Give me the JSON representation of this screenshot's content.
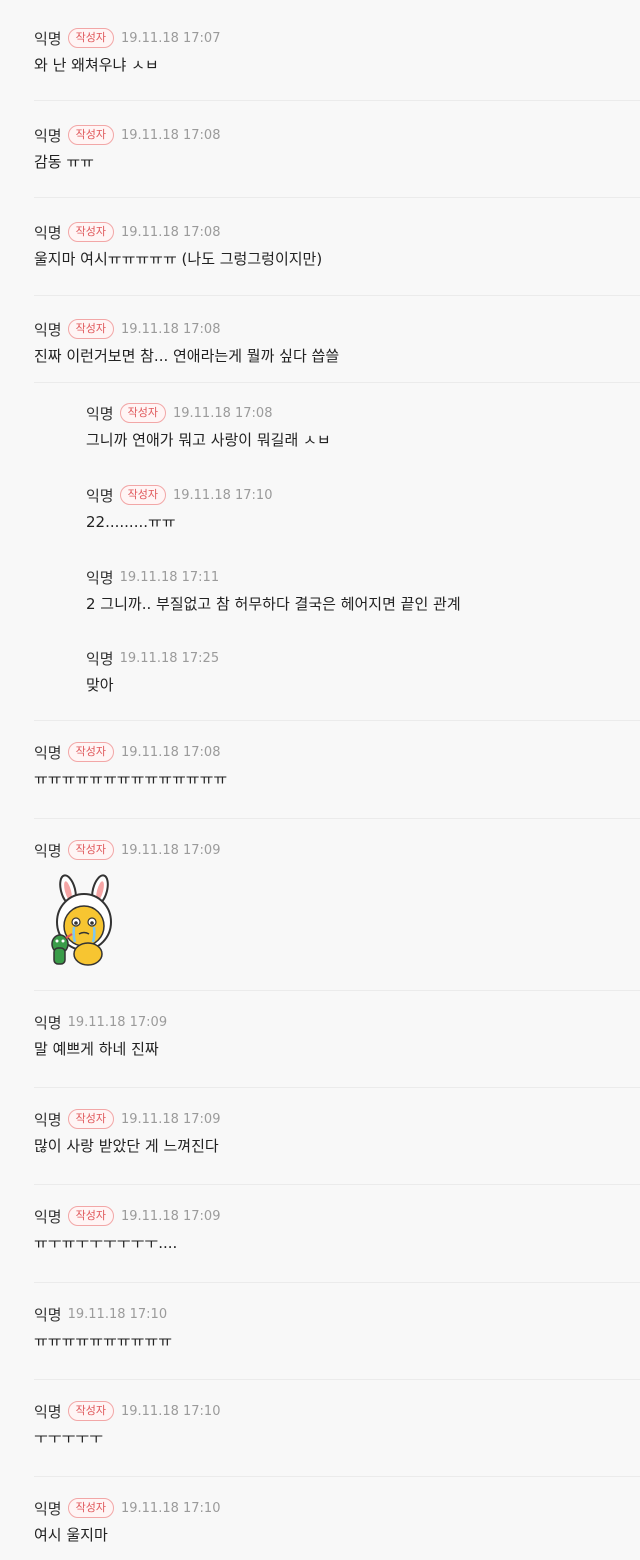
{
  "author_badge": "작성자",
  "comments": [
    {
      "name": "익명",
      "author": true,
      "time": "19.11.18 17:07",
      "text": "와 난 왜쳐우냐 ㅅㅂ",
      "reply": false
    },
    {
      "name": "익명",
      "author": true,
      "time": "19.11.18 17:08",
      "text": "감동 ㅠㅠ",
      "reply": false
    },
    {
      "name": "익명",
      "author": true,
      "time": "19.11.18 17:08",
      "text": "울지마 여시ㅠㅠㅠㅠㅠ (나도 그렁그렁이지만)",
      "reply": false
    },
    {
      "name": "익명",
      "author": true,
      "time": "19.11.18 17:08",
      "text": "진짜 이런거보면 참... 연애라는게 뭘까 싶다 씁쓸",
      "reply": false
    },
    {
      "name": "익명",
      "author": true,
      "time": "19.11.18 17:08",
      "text": "그니까 연애가 뭐고 사랑이 뭐길래 ㅅㅂ",
      "reply": true
    },
    {
      "name": "익명",
      "author": true,
      "time": "19.11.18 17:10",
      "text": "22.........ㅠㅠ",
      "reply": true
    },
    {
      "name": "익명",
      "author": false,
      "time": "19.11.18 17:11",
      "text": "2 그니까.. 부질없고 참 허무하다 결국은 헤어지면 끝인 관계",
      "reply": true
    },
    {
      "name": "익명",
      "author": false,
      "time": "19.11.18 17:25",
      "text": "맞아",
      "reply": true
    },
    {
      "name": "익명",
      "author": true,
      "time": "19.11.18 17:08",
      "text": "ㅠㅠㅠㅠㅠㅠㅠㅠㅠㅠㅠㅠㅠㅠ",
      "reply": false
    },
    {
      "name": "익명",
      "author": true,
      "time": "19.11.18 17:09",
      "text": "",
      "reply": false,
      "sticker": "crying-lion-bunny-sticker"
    },
    {
      "name": "익명",
      "author": false,
      "time": "19.11.18 17:09",
      "text": "말 예쁘게 하네 진짜",
      "reply": false
    },
    {
      "name": "익명",
      "author": true,
      "time": "19.11.18 17:09",
      "text": "많이 사랑 받았단 게 느껴진다",
      "reply": false
    },
    {
      "name": "익명",
      "author": true,
      "time": "19.11.18 17:09",
      "text": "ㅠㅜㅠㅜㅜㅜㅜㅜㅜ....",
      "reply": false
    },
    {
      "name": "익명",
      "author": false,
      "time": "19.11.18 17:10",
      "text": "ㅠㅠㅠㅠㅠㅠㅠㅠㅠㅠ",
      "reply": false
    },
    {
      "name": "익명",
      "author": true,
      "time": "19.11.18 17:10",
      "text": "ㅜㅜㅜㅜㅜ",
      "reply": false
    },
    {
      "name": "익명",
      "author": true,
      "time": "19.11.18 17:10",
      "text": "여시 울지마",
      "reply": false
    }
  ]
}
